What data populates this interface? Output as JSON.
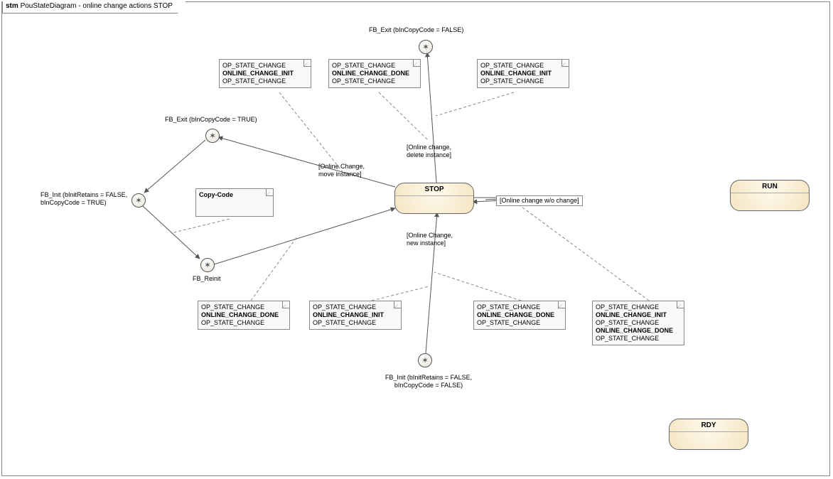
{
  "chart_data": {
    "type": "state_machine_diagram",
    "title_prefix": "stm",
    "title_main": "PouStateDiagram - online change actions STOP",
    "states": [
      {
        "id": "STOP",
        "label": "STOP"
      },
      {
        "id": "RUN",
        "label": "RUN"
      },
      {
        "id": "RDY",
        "label": "RDY"
      }
    ],
    "pseudo_states": [
      {
        "id": "ps_top",
        "label": "FB_Exit (bInCopyCode = FALSE)"
      },
      {
        "id": "ps_exit_t",
        "label": "FB_Exit (bInCopyCode = TRUE)"
      },
      {
        "id": "ps_init_t",
        "label_l1": "FB_Init (bInitRetains = FALSE,",
        "label_l2": "bInCopyCode = TRUE)"
      },
      {
        "id": "ps_reinit",
        "label": "FB_Reinit"
      },
      {
        "id": "ps_bottom",
        "label_l1": "FB_Init (bInitRetains = FALSE,",
        "label_l2": "bInCopyCode = FALSE)"
      }
    ],
    "notes": {
      "n1": {
        "l1": "OP_STATE_CHANGE",
        "l2": "ONLINE_CHANGE_INIT",
        "l3": "OP_STATE_CHANGE"
      },
      "n2": {
        "l1": "OP_STATE_CHANGE",
        "l2": "ONLINE_CHANGE_DONE",
        "l3": "OP_STATE_CHANGE"
      },
      "n3": {
        "l1": "OP_STATE_CHANGE",
        "l2": "ONLINE_CHANGE_INIT",
        "l3": "OP_STATE_CHANGE"
      },
      "copy": {
        "l1": "Copy-Code"
      },
      "n4": {
        "l1": "OP_STATE_CHANGE",
        "l2": "ONLINE_CHANGE_DONE",
        "l3": "OP_STATE_CHANGE"
      },
      "n5": {
        "l1": "OP_STATE_CHANGE",
        "l2": "ONLINE_CHANGE_INIT",
        "l3": "OP_STATE_CHANGE"
      },
      "n6": {
        "l1": "OP_STATE_CHANGE",
        "l2": "ONLINE_CHANGE_DONE",
        "l3": "OP_STATE_CHANGE"
      },
      "n7": {
        "l1": "OP_STATE_CHANGE",
        "l2": "ONLINE_CHANGE_INIT",
        "l3": "OP_STATE_CHANGE",
        "l4": "ONLINE_CHANGE_DONE",
        "l5": "OP_STATE_CHANGE"
      }
    },
    "transitions": [
      {
        "from": "STOP",
        "to": "ps_top",
        "guard_l1": "[Online change,",
        "guard_l2": "delete instance]"
      },
      {
        "from": "STOP",
        "to": "ps_exit_t",
        "guard_l1": "[Online Change,",
        "guard_l2": "move instance]"
      },
      {
        "from": "ps_exit_t",
        "to": "ps_init_t"
      },
      {
        "from": "ps_init_t",
        "to": "ps_reinit"
      },
      {
        "from": "ps_reinit",
        "to": "STOP"
      },
      {
        "from": "ps_bottom",
        "to": "STOP",
        "guard_l1": "[Online Change,",
        "guard_l2": "new instance]"
      },
      {
        "from": "STOP",
        "to": "STOP",
        "guard": "[Online change w/o change]"
      }
    ]
  }
}
